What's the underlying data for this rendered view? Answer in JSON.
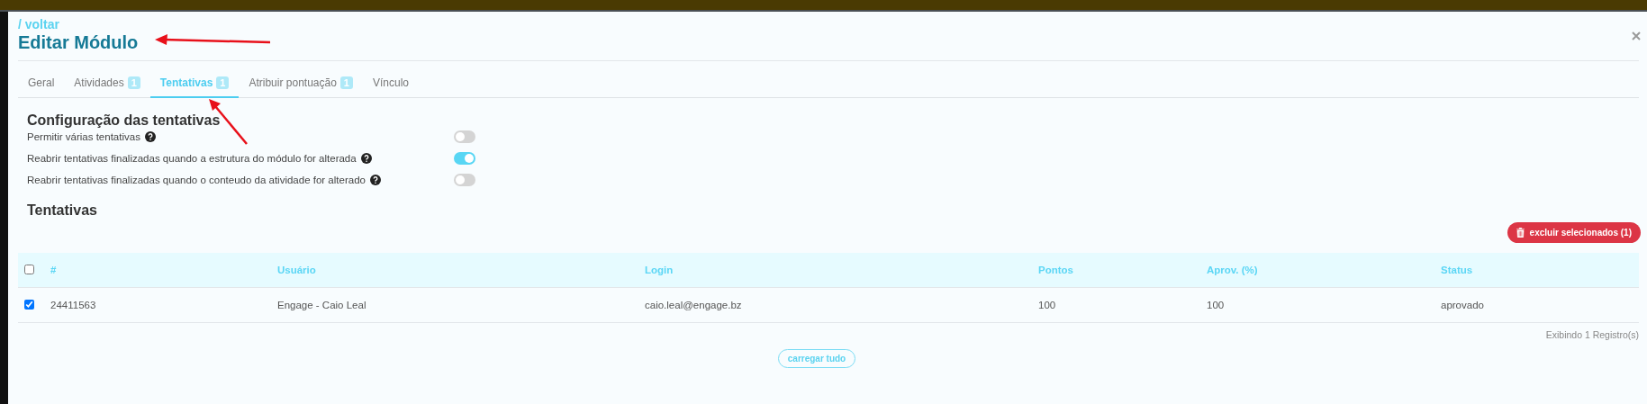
{
  "header": {
    "back_link": "/ voltar",
    "title": "Editar Módulo"
  },
  "tabs": [
    {
      "label": "Geral",
      "selected": false
    },
    {
      "label": "Atividades",
      "badge": "1",
      "selected": false
    },
    {
      "label": "Tentativas",
      "badge": "1",
      "selected": true
    },
    {
      "label": "Atribuir pontuação",
      "badge": "1",
      "selected": false
    },
    {
      "label": "Vínculo",
      "selected": false
    }
  ],
  "settings": {
    "title": "Configuração das tentativas",
    "options": [
      {
        "label": "Permitir várias tentativas",
        "on": false
      },
      {
        "label": "Reabrir tentativas finalizadas quando a estrutura do módulo for alterada",
        "on": true
      },
      {
        "label": "Reabrir tentativas finalizadas quando o conteudo da atividade for alterado",
        "on": false
      }
    ]
  },
  "attempts": {
    "title": "Tentativas",
    "delete_button": "excluir selecionados (1)",
    "table": {
      "select_all": false,
      "columns": [
        "#",
        "Usuário",
        "Login",
        "Pontos",
        "Aprov. (%)",
        "Status"
      ],
      "rows": [
        {
          "selected": true,
          "cells": [
            "24411563",
            "Engage - Caio Leal",
            "caio.leal@engage.bz",
            "100",
            "100",
            "aprovado"
          ]
        }
      ]
    },
    "footer": "Exibindo 1 Registro(s)",
    "load_all_button": "carregar tudo"
  }
}
